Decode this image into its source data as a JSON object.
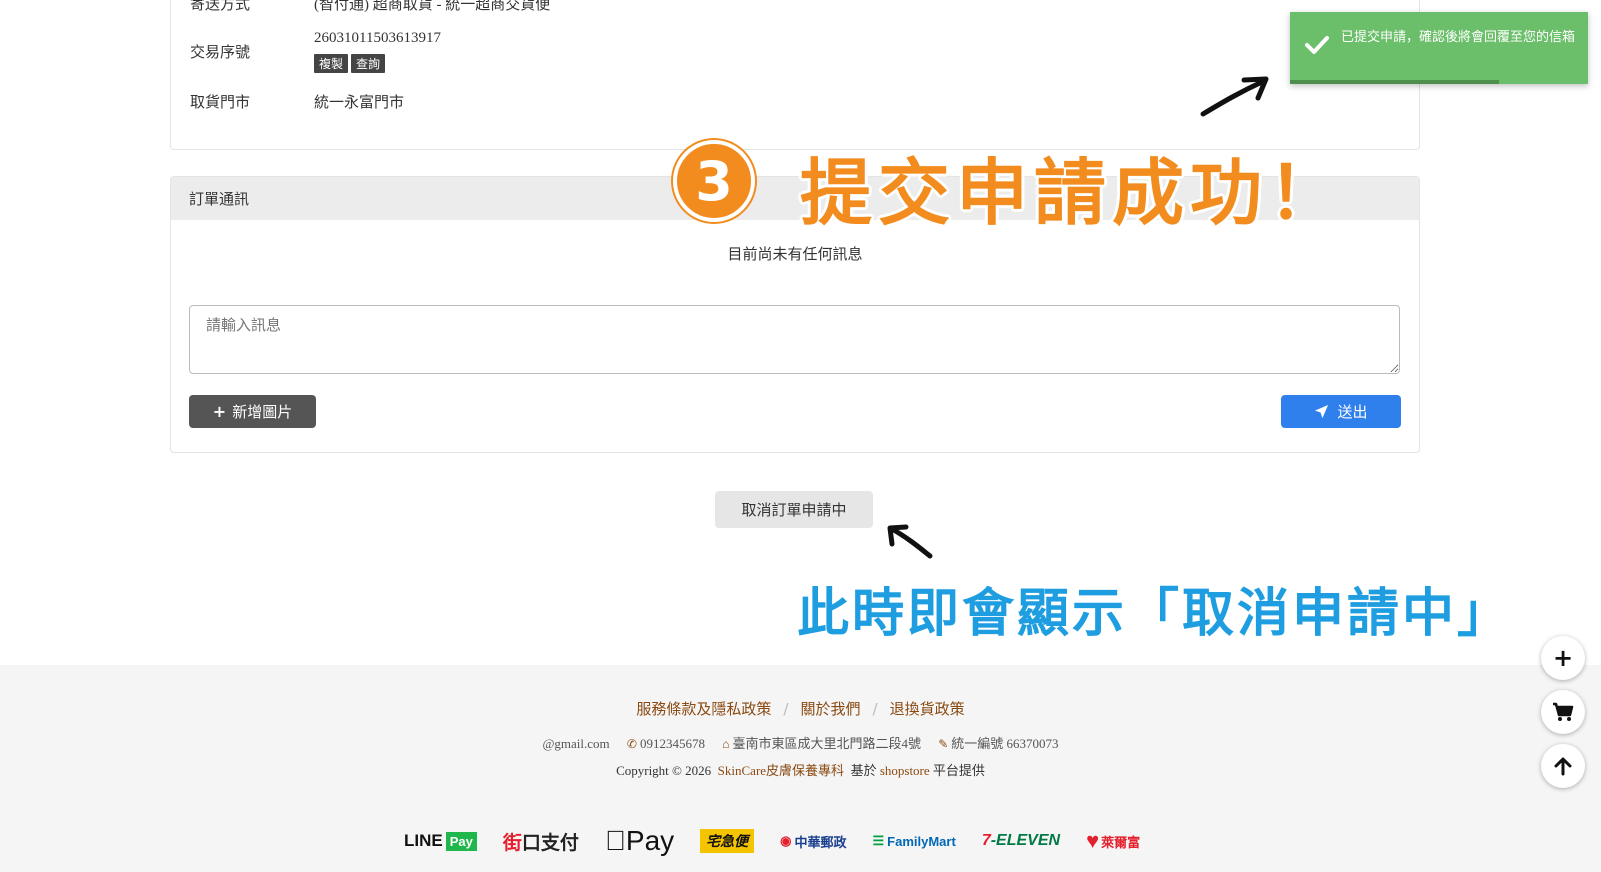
{
  "order_info": {
    "rows": [
      {
        "label": "寄送方式",
        "value": "(智付通) 超商取貨 - 統一超商交貨便"
      },
      {
        "label": "交易序號",
        "value": "26031011503613917"
      },
      {
        "label": "取貨門市",
        "value": "統一永富門市"
      }
    ],
    "copy_label": "複製",
    "query_label": "查詢"
  },
  "messages": {
    "header": "訂單通訊",
    "empty_text": "目前尚未有任何訊息",
    "input_placeholder": "請輸入訊息",
    "add_image_label": "新增圖片",
    "send_label": "送出"
  },
  "cancel_button_label": "取消訂單申請中",
  "annotations": {
    "step_number": "3",
    "step_title": "提交申請成功！",
    "note": "此時即會顯示「取消申請中」"
  },
  "toast": {
    "message": "已提交申請，確認後將會回覆至您的信箱",
    "progress": 0.7
  },
  "footer": {
    "links": [
      "服務條款及隱私政策",
      "關於我們",
      "退換貨政策"
    ],
    "email": "@gmail.com",
    "phone": "0912345678",
    "address": "臺南市東區成大里北門路二段4號",
    "tax_id": "統一編號 66370073",
    "copyright_prefix": "Copyright © 2026",
    "brand": "SkinCare皮膚保養專科",
    "based_on": "基於",
    "platform": "shopstore",
    "platform_suffix": "平台提供",
    "payment_logos": [
      "LINE Pay",
      "街口支付",
      "Apple Pay",
      "宅急便",
      "中華郵政",
      "FamilyMart",
      "7-ELEVEN",
      "萊爾富"
    ]
  },
  "colors": {
    "annotation_orange": "#f28c1e",
    "annotation_blue": "#1e9ee0",
    "toast_green": "#6cbf6a",
    "send_blue": "#2f80ed",
    "footer_link": "#8a4a12"
  }
}
